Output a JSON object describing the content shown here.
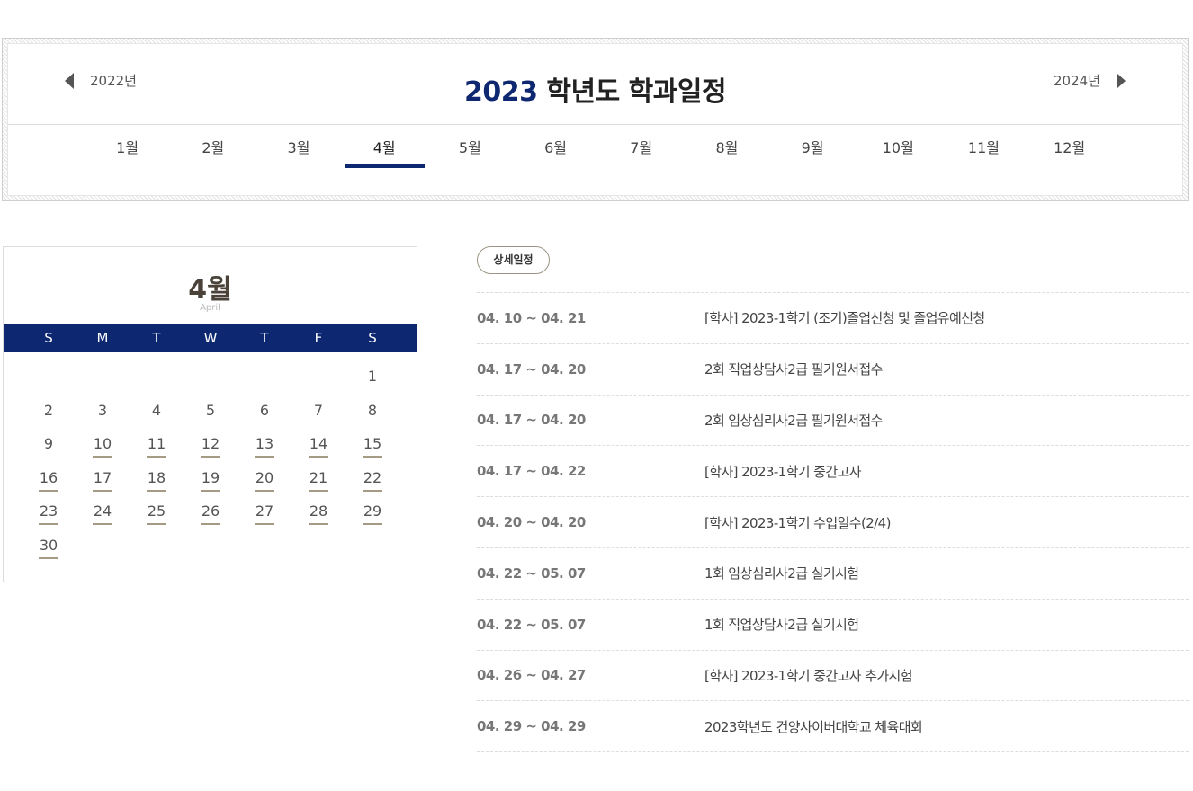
{
  "year_nav": {
    "prev_label": "2022년",
    "next_label": "2024년",
    "title_year": "2023",
    "title_text": " 학년도 학과일정"
  },
  "months": [
    "1월",
    "2월",
    "3월",
    "4월",
    "5월",
    "6월",
    "7월",
    "8월",
    "9월",
    "10월",
    "11월",
    "12월"
  ],
  "active_month_index": 3,
  "calendar": {
    "month_label": "4월",
    "month_label_en": "April",
    "weekdays": [
      "S",
      "M",
      "T",
      "W",
      "T",
      "F",
      "S"
    ],
    "leading_blanks": 6,
    "days": [
      "1",
      "2",
      "3",
      "4",
      "5",
      "6",
      "7",
      "8",
      "9",
      "10",
      "11",
      "12",
      "13",
      "14",
      "15",
      "16",
      "17",
      "18",
      "19",
      "20",
      "21",
      "22",
      "23",
      "24",
      "25",
      "26",
      "27",
      "28",
      "29",
      "30"
    ],
    "event_days": [
      "10",
      "11",
      "12",
      "13",
      "14",
      "15",
      "16",
      "17",
      "18",
      "19",
      "20",
      "21",
      "22",
      "23",
      "24",
      "25",
      "26",
      "27",
      "28",
      "29",
      "30"
    ]
  },
  "detail_label": "상세일정",
  "schedule": [
    {
      "date": "04. 10 ~ 04. 21",
      "title": "[학사] 2023-1학기 (조기)졸업신청 및 졸업유예신청"
    },
    {
      "date": "04. 17 ~ 04. 20",
      "title": "2회 직업상담사2급 필기원서접수"
    },
    {
      "date": "04. 17 ~ 04. 20",
      "title": "2회 임상심리사2급 필기원서접수"
    },
    {
      "date": "04. 17 ~ 04. 22",
      "title": "[학사] 2023-1학기 중간고사"
    },
    {
      "date": "04. 20 ~ 04. 20",
      "title": "[학사] 2023-1학기 수업일수(2/4)"
    },
    {
      "date": "04. 22 ~ 05. 07",
      "title": "1회 임상심리사2급 실기시험"
    },
    {
      "date": "04. 22 ~ 05. 07",
      "title": "1회 직업상담사2급 실기시험"
    },
    {
      "date": "04. 26 ~ 04. 27",
      "title": "[학사] 2023-1학기 중간고사 추가시험"
    },
    {
      "date": "04. 29 ~ 04. 29",
      "title": "2023학년도 건양사이버대학교 체육대회"
    }
  ],
  "colors": {
    "accent": "#0d2770",
    "underline": "#a59a83"
  }
}
